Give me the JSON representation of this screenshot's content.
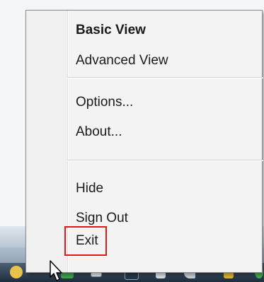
{
  "menu": {
    "items": [
      {
        "label": "Basic View",
        "bold": true
      },
      {
        "label": "Advanced View",
        "bold": false
      },
      {
        "label": "Options...",
        "bold": false
      },
      {
        "label": "About...",
        "bold": false
      },
      {
        "label": "Hide",
        "bold": false
      },
      {
        "label": "Sign Out",
        "bold": false
      },
      {
        "label": "Exit",
        "bold": false
      }
    ],
    "highlight_color": "#e01a1a"
  },
  "icons": {
    "cursor": "mouse-pointer-icon",
    "tray": [
      "tray-app-icon",
      "tray-app-icon",
      "tray-app-icon",
      "tray-app-icon",
      "tray-app-icon",
      "tray-app-icon",
      "tray-app-icon",
      "tray-app-icon"
    ]
  }
}
